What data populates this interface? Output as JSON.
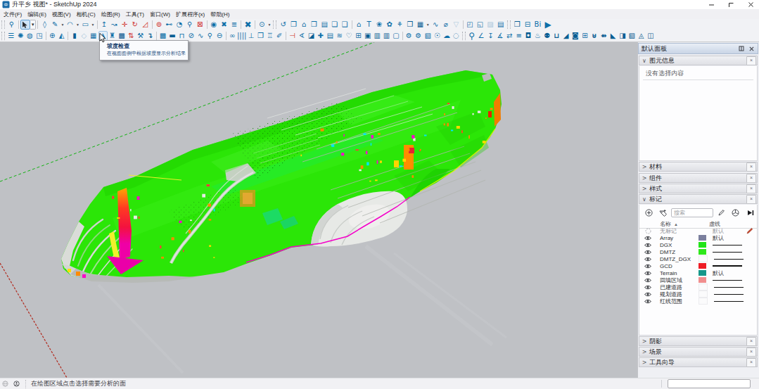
{
  "window": {
    "title": "升平乡 视图* - SketchUp 2024",
    "controls": {
      "minimize": "minimize",
      "maximize": "maximize",
      "close": "close"
    }
  },
  "menu": {
    "items": [
      "文件(F)",
      "编辑(E)",
      "视图(V)",
      "相机(C)",
      "绘图(R)",
      "工具(T)",
      "窗口(W)",
      "扩展程序(x)",
      "帮助(H)"
    ]
  },
  "toolbar_row1": [
    {
      "t": "grip"
    },
    {
      "n": "zoom-extents-tool",
      "g": "⚲"
    },
    {
      "t": "sep"
    },
    {
      "n": "select-tool",
      "svg": "cursor",
      "active": true
    },
    {
      "n": "select-tool-dropdown",
      "t": "ddbtn"
    },
    {
      "t": "sep"
    },
    {
      "n": "eraser-tool",
      "g": "◊"
    },
    {
      "n": "line-tool",
      "g": "✎"
    },
    {
      "n": "line-tool-dropdown",
      "t": "dd"
    },
    {
      "n": "arc-tool",
      "g": "◠"
    },
    {
      "n": "arc-tool-dropdown",
      "t": "dd"
    },
    {
      "n": "rectangle-tool",
      "g": "▭"
    },
    {
      "n": "rectangle-tool-dropdown",
      "t": "dd"
    },
    {
      "t": "sep"
    },
    {
      "n": "push-pull-tool",
      "g": "↥"
    },
    {
      "n": "follow-me-tool",
      "g": "↝"
    },
    {
      "n": "move-tool",
      "g": "✛",
      "red": true
    },
    {
      "n": "rotate-tool",
      "g": "↻",
      "red": true
    },
    {
      "n": "scale-tool",
      "g": "◿",
      "red": true
    },
    {
      "t": "sep"
    },
    {
      "n": "offset-tool",
      "g": "⊚",
      "red": true
    },
    {
      "n": "tape-measure-tool",
      "g": "⊷"
    },
    {
      "n": "protractor-tool",
      "g": "◔"
    },
    {
      "n": "zoom-tool",
      "g": "⚲"
    },
    {
      "n": "zoom-window-tool",
      "g": "⊠",
      "red": true
    },
    {
      "t": "sep"
    },
    {
      "n": "position-camera-tool",
      "g": "◉"
    },
    {
      "n": "look-around-tool",
      "g": "✖"
    },
    {
      "n": "walk-tool",
      "g": "≣"
    },
    {
      "t": "sep"
    },
    {
      "n": "section-plane-tool",
      "g": "✖",
      "big": true
    },
    {
      "t": "sep"
    },
    {
      "n": "styles-dropdown",
      "g": "⊙"
    },
    {
      "n": "styles-dropdown-arrow",
      "t": "dd"
    },
    {
      "t": "grip"
    },
    {
      "n": "generate-report",
      "g": "↺"
    },
    {
      "n": "new-document",
      "g": "❐"
    },
    {
      "n": "open-model",
      "g": "⌂"
    },
    {
      "n": "save-model",
      "g": "❒"
    },
    {
      "n": "model-info",
      "g": "▤"
    },
    {
      "n": "copy-page",
      "g": "❏"
    },
    {
      "n": "paste-page",
      "g": "❑"
    },
    {
      "t": "sep"
    },
    {
      "n": "home-view",
      "g": "⌂"
    },
    {
      "n": "text-tool",
      "g": "T"
    },
    {
      "n": "flower-component",
      "g": "❀"
    },
    {
      "n": "leaf-component",
      "g": "✿"
    },
    {
      "n": "wind-turbine-component",
      "g": "⚘"
    },
    {
      "n": "3d-boxes",
      "g": "❒",
      "dark": true
    },
    {
      "n": "grid-tool",
      "g": "▦",
      "dark": true
    },
    {
      "n": "grid-tool-dropdown",
      "t": "dd"
    },
    {
      "n": "curve-fit-tool",
      "g": "∿"
    },
    {
      "n": "hide-edges-tool",
      "g": "⌀"
    },
    {
      "n": "ghost-tool",
      "g": "▽",
      "dis": true
    },
    {
      "t": "sep"
    },
    {
      "n": "crop-box-tool",
      "g": "◰"
    },
    {
      "n": "cut-box-tool",
      "g": "◱"
    },
    {
      "n": "image-tool",
      "g": "▨",
      "dis": true
    },
    {
      "n": "page-list-tool",
      "g": "▤"
    },
    {
      "t": "grip"
    },
    {
      "n": "copy-sheets-tool",
      "g": "❐",
      "dark": true
    },
    {
      "n": "merge-sheets-tool",
      "g": "⊟"
    },
    {
      "n": "bim-tool",
      "g": "Bi"
    },
    {
      "n": "run-animation",
      "g": "▶",
      "big": true
    }
  ],
  "toolbar_row2": [
    {
      "t": "grip"
    },
    {
      "n": "layer-lines-tool",
      "g": "☰"
    },
    {
      "n": "gear-flower-tool",
      "g": "✺"
    },
    {
      "n": "globe-tool",
      "g": "◍"
    },
    {
      "n": "selection-frame-tool",
      "g": "◳"
    },
    {
      "t": "sep"
    },
    {
      "n": "helmet-tool",
      "g": "⊕"
    },
    {
      "n": "terrain-mountain-tool",
      "g": "◭"
    },
    {
      "t": "sep"
    },
    {
      "n": "solid-block-tool",
      "g": "▮",
      "dark": true
    },
    {
      "n": "diamond-tool",
      "g": "◇",
      "dis": true
    },
    {
      "n": "grid-analysis-tool",
      "g": "▦"
    },
    {
      "n": "slope-analysis-tool",
      "g": "◮",
      "hovered": true
    },
    {
      "n": "pavilion-tool",
      "g": "♜"
    },
    {
      "n": "dark-grid-tool",
      "g": "▩",
      "dark": true
    },
    {
      "n": "updown-arrows-tool",
      "g": "⇅",
      "red": true
    },
    {
      "n": "wrench-tool",
      "g": "⚒"
    },
    {
      "n": "pipe-hook-tool",
      "g": "↴",
      "dark": true
    },
    {
      "t": "sep"
    },
    {
      "n": "pixel-grid-tool",
      "g": "▩"
    },
    {
      "n": "solid-bar-tool",
      "g": "▬",
      "dark": true
    },
    {
      "n": "clamp-tool",
      "g": "⊓"
    },
    {
      "n": "circle-slash-tool",
      "g": "⊘"
    },
    {
      "n": "wave-tool",
      "g": "∿"
    },
    {
      "n": "find-person-tool",
      "g": "⚲"
    },
    {
      "n": "download-circle-tool",
      "g": "⊖"
    },
    {
      "t": "sep"
    },
    {
      "n": "chain-link-tool",
      "g": "∞"
    },
    {
      "n": "fence-tool",
      "g": "||||"
    },
    {
      "n": "pipe-t-tool",
      "g": "⊥"
    },
    {
      "n": "window-copy-tool",
      "g": "❐"
    },
    {
      "n": "bank-tool",
      "g": "♖"
    },
    {
      "n": "pencil-tool",
      "g": "✐"
    },
    {
      "t": "sep"
    },
    {
      "n": "red-blue-pipes-tool",
      "g": "⊣",
      "red": true
    },
    {
      "n": "protractor-pencil-tool",
      "g": "∢"
    },
    {
      "n": "dark-tag-tool",
      "g": "◪",
      "dark": true
    },
    {
      "n": "blue-cross-tool",
      "g": "✚"
    },
    {
      "n": "list-panel-tool",
      "g": "▤"
    },
    {
      "n": "slider-lines-tool",
      "g": "≋"
    },
    {
      "n": "shield-heart-tool",
      "g": "♡",
      "dark": true
    },
    {
      "n": "hand-card-tool",
      "g": "⊞"
    },
    {
      "n": "suitcase-tool",
      "g": "▣",
      "dark": true
    },
    {
      "n": "clipboard-tool-1",
      "g": "▥",
      "dark": true
    },
    {
      "n": "clipboard-tool-2",
      "g": "▥",
      "dark": true
    },
    {
      "n": "outline-page-tool",
      "g": "▢"
    },
    {
      "t": "sep"
    },
    {
      "n": "gear-tool",
      "g": "⚙"
    },
    {
      "n": "gear-run-tool",
      "g": "⚙"
    },
    {
      "n": "photo-export-tool",
      "g": "▧"
    },
    {
      "n": "circle-question-tool",
      "g": "☉"
    },
    {
      "n": "cloud-upload-tool",
      "g": "☁"
    },
    {
      "n": "broken-circle-tool",
      "g": "◌"
    },
    {
      "t": "grip"
    },
    {
      "n": "big-magnifier-tool",
      "g": "⚲",
      "big": true
    },
    {
      "n": "angle-ruler-tool",
      "g": "∠"
    },
    {
      "n": "ibeam-arrows-tool",
      "g": "↧"
    },
    {
      "n": "pencil-slope-tool",
      "g": "∡"
    },
    {
      "n": "double-arrows-tool",
      "g": "⇄"
    },
    {
      "n": "doc-lines-tool",
      "g": "≡"
    },
    {
      "n": "padlock-tool",
      "g": "◘",
      "dark": true
    },
    {
      "n": "flask-tool",
      "g": "♨"
    },
    {
      "n": "ant-tool",
      "g": "⚉",
      "dark": true
    },
    {
      "n": "box-lid-tool",
      "g": "⊔",
      "dark": true
    },
    {
      "n": "dark-wedge-tool",
      "g": "◢",
      "dark": true
    },
    {
      "n": "dark-square-circle-tool",
      "g": "◙",
      "dark": true
    },
    {
      "n": "double-window-tool",
      "g": "⊞"
    },
    {
      "n": "pot-tool",
      "g": "⊎",
      "dark": true
    },
    {
      "n": "pipe-arrow-tool",
      "g": "⇻",
      "dark": true
    },
    {
      "n": "slope-fill-tool",
      "g": "◣",
      "dark": true
    },
    {
      "n": "box-cursor-tool",
      "g": "◨",
      "dark": true
    },
    {
      "n": "image-mountain-tool",
      "g": "▧",
      "dark": true
    },
    {
      "n": "terrain-swap-tool",
      "g": "◬",
      "dark": true
    },
    {
      "n": "export-scene-tool",
      "g": "◫",
      "dark": true
    }
  ],
  "tooltip": {
    "title": "坡度检查",
    "description": "在视图图例中根据坡度显示分析结果"
  },
  "viewport": {
    "background": "#bfc1c5",
    "axis_green": "#12b212",
    "axis_red": "#c03224",
    "model_green": "#2be607"
  },
  "tray": {
    "title": "默认面板",
    "header_buttons": {
      "pin": "auto-hide",
      "close": "close"
    },
    "sections": {
      "entity_info": {
        "title": "图元信息",
        "state": "expanded",
        "message": "没有选择内容"
      },
      "materials": {
        "title": "材料",
        "state": "collapsed"
      },
      "components": {
        "title": "组件",
        "state": "collapsed"
      },
      "styles": {
        "title": "样式",
        "state": "collapsed"
      },
      "tags": {
        "title": "标记",
        "state": "expanded"
      },
      "shadows": {
        "title": "阴影",
        "state": "collapsed"
      },
      "scenes": {
        "title": "场景",
        "state": "collapsed"
      },
      "instructor": {
        "title": "工具向导",
        "state": "collapsed"
      }
    },
    "tags_panel": {
      "filter_placeholder": "搜索",
      "columns": {
        "name": "名称",
        "dashes": "虚线"
      },
      "rows": [
        {
          "name": "无标记",
          "dash": "默认",
          "untagged": true,
          "current": true
        },
        {
          "name": "Array",
          "dash": "默认",
          "color": "#7b7f9e"
        },
        {
          "name": "DGX",
          "dash": "line",
          "color": "#21e418"
        },
        {
          "name": "DMTZ",
          "dash": "line",
          "color": "#2fe81c"
        },
        {
          "name": "DMTZ_DGX",
          "dash": "line",
          "color": "#fbfbfc"
        },
        {
          "name": "GCD",
          "dash": "line-thick",
          "color": "#ee1c25"
        },
        {
          "name": "Terrain",
          "dash": "默认",
          "color": "#16978a"
        },
        {
          "name": "回填区域",
          "dash": "line",
          "color": "#f08e8e"
        },
        {
          "name": "已建道路",
          "dash": "line",
          "color": "#fbfbfc"
        },
        {
          "name": "规划道路",
          "dash": "line",
          "color": "#fbfbfc"
        },
        {
          "name": "红线范围",
          "dash": "line",
          "color": "#fbfbfc"
        }
      ]
    }
  },
  "statusbar": {
    "text": "在绘图区域点击选择需要分析的面",
    "measurement_value": ""
  }
}
